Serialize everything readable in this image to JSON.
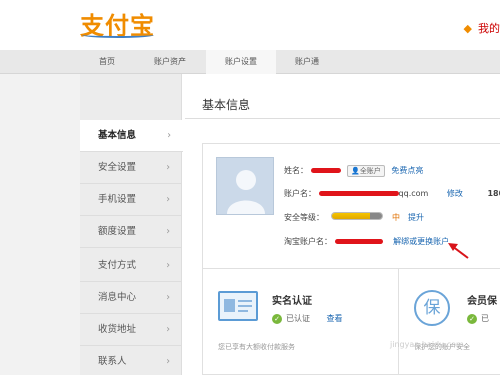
{
  "header": {
    "logo": "支付宝",
    "right_link": "我的"
  },
  "nav": {
    "tabs": [
      "首页",
      "账户资产",
      "账户设置",
      "账户通"
    ],
    "active_index": 2
  },
  "sidebar": {
    "items": [
      {
        "label": "基本信息",
        "active": true
      },
      {
        "label": "安全设置"
      },
      {
        "label": "手机设置"
      },
      {
        "label": "额度设置"
      },
      {
        "label": "支付方式"
      },
      {
        "label": "消息中心"
      },
      {
        "label": "收货地址"
      },
      {
        "label": "联系人"
      }
    ],
    "chevron": "›"
  },
  "main": {
    "title": "基本信息",
    "name_label": "姓名：",
    "name_badge": "全账户",
    "name_link": "免费点亮",
    "account_label": "账户名：",
    "account_suffix": "qq.com",
    "account_edit": "修改",
    "account_extra": "180",
    "security_label": "安全等级：",
    "security_level": "中",
    "security_level_pct": 0.75,
    "security_link": "提升",
    "taobao_label": "淘宝账户名：",
    "taobao_link": "解绑或更换账户"
  },
  "cards": {
    "realname_title": "实名认证",
    "realname_status": "已认证",
    "realname_link": "查看",
    "realname_note": "您已享有大额收付款服务",
    "member_title": "会员保",
    "member_icon": "保",
    "member_status": "已",
    "member_note": "保护您的账户安全"
  },
  "colors": {
    "brand": "#f08c00",
    "link": "#1a66b0",
    "redaction": "#e0141a",
    "ok": "#7ab83c",
    "arrow": "#d8141a"
  },
  "watermark": "jingyan.baidu.com"
}
